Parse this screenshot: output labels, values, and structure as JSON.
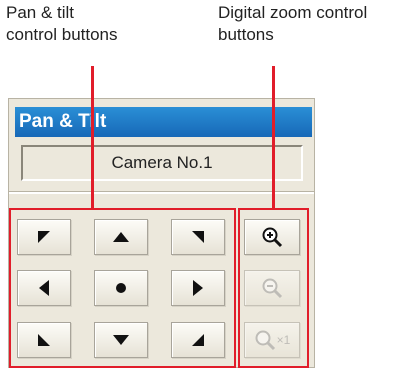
{
  "annotations": {
    "pan_tilt_line1": "Pan & tilt",
    "pan_tilt_line2": "control buttons",
    "zoom_line1": "Digital zoom control",
    "zoom_line2": "buttons"
  },
  "panel": {
    "title": "Pan & Tilt",
    "camera_name": "Camera No.1"
  },
  "pan_tilt_buttons": [
    {
      "name": "up-left",
      "icon": "arrow-up-left-icon"
    },
    {
      "name": "up",
      "icon": "arrow-up-icon"
    },
    {
      "name": "up-right",
      "icon": "arrow-up-right-icon"
    },
    {
      "name": "left",
      "icon": "arrow-left-icon"
    },
    {
      "name": "home",
      "icon": "home-dot-icon"
    },
    {
      "name": "right",
      "icon": "arrow-right-icon"
    },
    {
      "name": "down-left",
      "icon": "arrow-down-left-icon"
    },
    {
      "name": "down",
      "icon": "arrow-down-icon"
    },
    {
      "name": "down-right",
      "icon": "arrow-down-right-icon"
    }
  ],
  "zoom_buttons": [
    {
      "name": "zoom-in",
      "icon": "zoom-in-icon",
      "enabled": true
    },
    {
      "name": "zoom-out",
      "icon": "zoom-out-icon",
      "enabled": false
    },
    {
      "name": "zoom-reset",
      "icon": "zoom-reset-icon",
      "label": "×1",
      "enabled": false
    }
  ],
  "colors": {
    "title_bar": "#1b74c4",
    "callout": "#e11d2a",
    "panel_bg": "#ece8dc"
  }
}
